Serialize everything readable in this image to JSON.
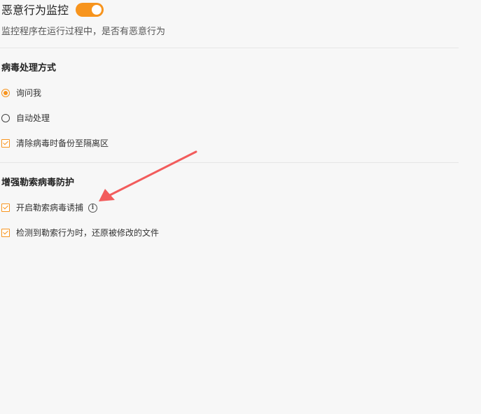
{
  "malicious_monitor": {
    "title": "恶意行为监控",
    "toggle_on": true,
    "description": "监控程序在运行过程中，是否有恶意行为"
  },
  "virus_handling": {
    "title": "病毒处理方式",
    "options": [
      {
        "label": "询问我",
        "selected": true
      },
      {
        "label": "自动处理",
        "selected": false
      }
    ],
    "backup_checkbox": {
      "label": "清除病毒时备份至隔离区",
      "checked": true
    }
  },
  "ransomware": {
    "title": "增强勒索病毒防护",
    "trap_checkbox": {
      "label": "开启勒索病毒诱捕",
      "checked": true,
      "info_icon": "info-icon"
    },
    "restore_checkbox": {
      "label": "检测到勒索行为时，还原被修改的文件",
      "checked": true
    }
  },
  "colors": {
    "accent": "#f7941d",
    "annotation_arrow": "#f25c5c"
  }
}
